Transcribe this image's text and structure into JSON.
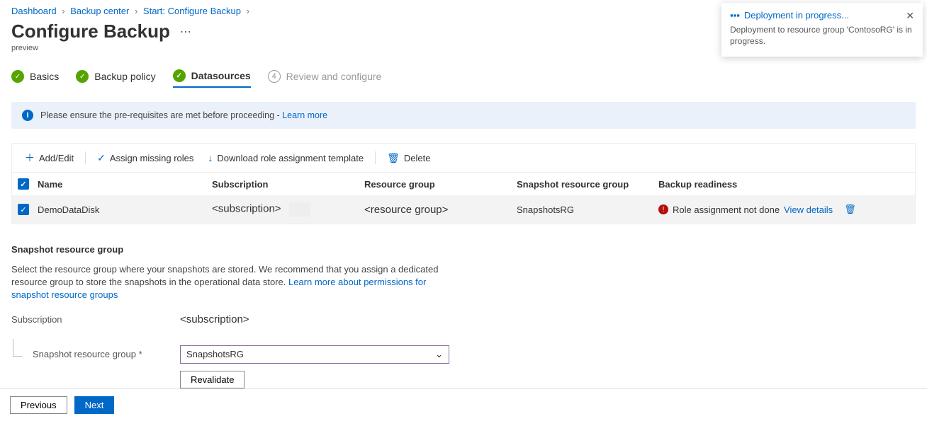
{
  "breadcrumb": {
    "items": [
      "Dashboard",
      "Backup center",
      "Start: Configure Backup"
    ]
  },
  "header": {
    "title": "Configure Backup",
    "preview": "preview"
  },
  "steps": [
    {
      "label": "Basics",
      "state": "done"
    },
    {
      "label": "Backup policy",
      "state": "done"
    },
    {
      "label": "Datasources",
      "state": "active"
    },
    {
      "label": "Review and configure",
      "state": "pending",
      "num": "4"
    }
  ],
  "banner": {
    "text": "Please ensure the pre-requisites are met before proceeding - ",
    "link": "Learn more"
  },
  "toolbar": {
    "add": "Add/Edit",
    "assign": "Assign missing roles",
    "download": "Download role assignment template",
    "delete": "Delete"
  },
  "grid": {
    "headers": {
      "name": "Name",
      "subscription": "Subscription",
      "rg": "Resource group",
      "snapshot": "Snapshot resource group",
      "readiness": "Backup readiness"
    },
    "rows": [
      {
        "name": "DemoDataDisk",
        "subscription": "<subscription>",
        "rg": "<resource group>",
        "snapshot": "SnapshotsRG",
        "readinessText": "Role assignment not done",
        "readinessLink": "View details"
      }
    ]
  },
  "section": {
    "title": "Snapshot resource group",
    "desc": "Select the resource group where your snapshots are stored. We recommend that you assign a dedicated resource group to store the snapshots in the operational data store. ",
    "descLink": "Learn more about permissions for snapshot resource groups",
    "form": {
      "subscriptionLabel": "Subscription",
      "subscriptionValue": "<subscription>",
      "srgLabel": "Snapshot resource group *",
      "srgValue": "SnapshotsRG",
      "revalidate": "Revalidate"
    }
  },
  "footer": {
    "previous": "Previous",
    "next": "Next"
  },
  "toast": {
    "title": "Deployment in progress...",
    "body": "Deployment to resource group 'ContosoRG' is in progress."
  }
}
